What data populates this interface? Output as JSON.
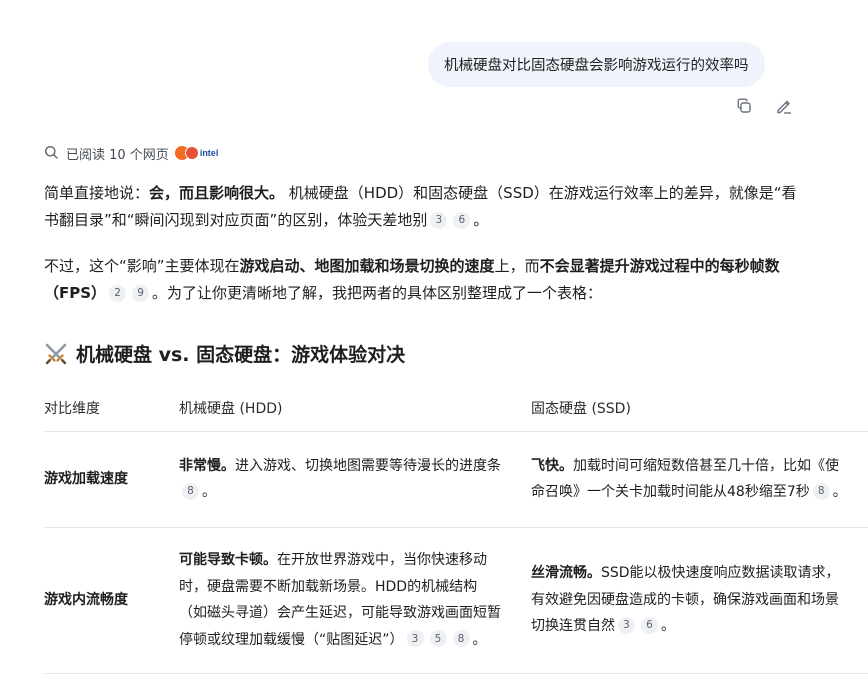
{
  "user_message": "机械硬盘对比固态硬盘会影响游戏运行的效率吗",
  "actions": {
    "copy_icon": "copy-icon",
    "edit_icon": "edit-icon"
  },
  "read_status": "已阅读 10 个网页",
  "source_brand": "intel",
  "para1": {
    "t1": "简单直接地说：",
    "b1": "会，而且影响很大。",
    "t2": " 机械硬盘（HDD）和固态硬盘（SSD）在游戏运行效率上的差异，就像是“看书翻目录”和“瞬间闪现到对应页面”的区别，体验天差地别",
    "c1": "3",
    "c2": "6",
    "t3": "。"
  },
  "para2": {
    "t1": "不过，这个“影响”主要体现在",
    "b1": "游戏启动、地图加载和场景切换的速度",
    "t2": "上，而",
    "b2": "不会显著提升游戏过程中的每秒帧数（FPS）",
    "c1": "2",
    "c2": "9",
    "t3": "。为了让你更清晰地了解，我把两者的具体区别整理成了一个表格："
  },
  "section_title": "机械硬盘 vs. 固态硬盘：游戏体验对决",
  "table": {
    "headers": [
      "对比维度",
      "机械硬盘 (HDD)",
      "固态硬盘 (SSD)"
    ],
    "rows": [
      {
        "dimension": "游戏加载速度",
        "hdd_bold": "非常慢。",
        "hdd_text": "进入游戏、切换地图需要等待漫长的进度条",
        "hdd_cites": [
          "8"
        ],
        "hdd_end": "。",
        "ssd_bold": "飞快。",
        "ssd_text": "加载时间可缩短数倍甚至几十倍，比如《使命召唤》一个关卡加载时间能从48秒缩至7秒",
        "ssd_cites": [
          "8"
        ],
        "ssd_end": "。"
      },
      {
        "dimension": "游戏内流畅度",
        "hdd_bold": "可能导致卡顿。",
        "hdd_text": "在开放世界游戏中，当你快速移动时，硬盘需要不断加载新场景。HDD的机械结构（如磁头寻道）会产生延迟，可能导致游戏画面短暂停顿或纹理加载缓慢（“贴图延迟”）",
        "hdd_cites": [
          "3",
          "5",
          "8"
        ],
        "hdd_end": "。",
        "ssd_bold": "丝滑流畅。",
        "ssd_text": "SSD能以极快速度响应数据读取请求，有效避免因硬盘造成的卡顿，确保游戏画面和场景切换连贯自然",
        "ssd_cites": [
          "3",
          "6"
        ],
        "ssd_end": "。"
      }
    ]
  }
}
